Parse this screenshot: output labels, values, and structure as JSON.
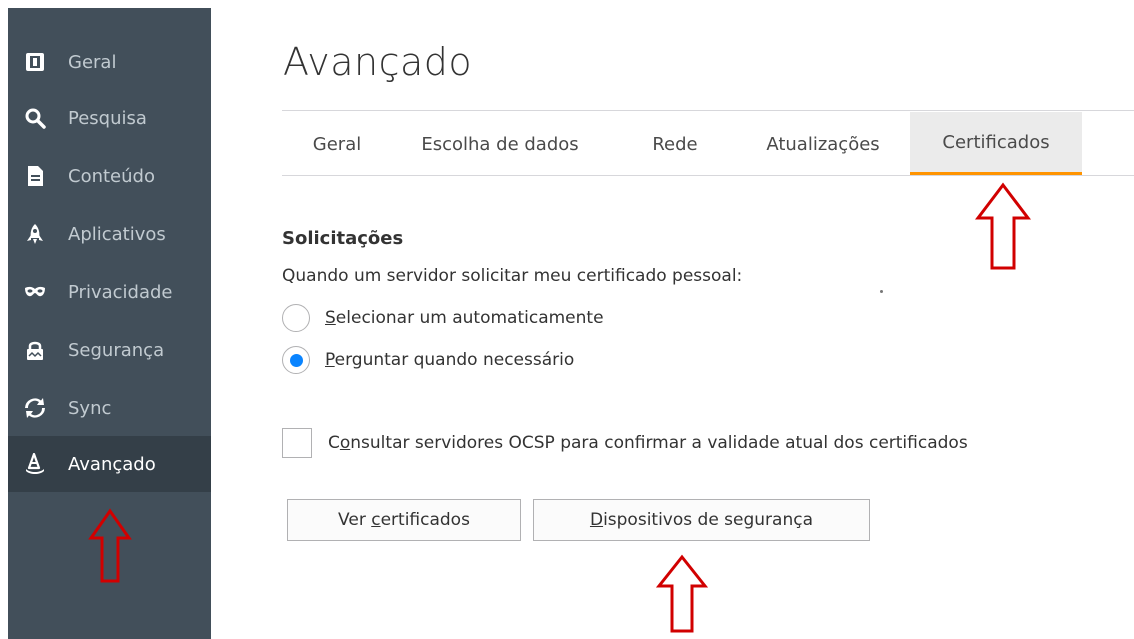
{
  "sidebar": {
    "items": [
      {
        "label": "Geral",
        "icon": "general-icon"
      },
      {
        "label": "Pesquisa",
        "icon": "search-icon"
      },
      {
        "label": "Conteúdo",
        "icon": "document-icon"
      },
      {
        "label": "Aplicativos",
        "icon": "rocket-icon"
      },
      {
        "label": "Privacidade",
        "icon": "mask-icon"
      },
      {
        "label": "Segurança",
        "icon": "lock-icon"
      },
      {
        "label": "Sync",
        "icon": "sync-icon"
      },
      {
        "label": "Avançado",
        "icon": "wizard-hat-icon"
      }
    ],
    "active_index": 7
  },
  "main": {
    "title": "Avançado",
    "tabs": [
      {
        "label": "Geral"
      },
      {
        "label": "Escolha de dados"
      },
      {
        "label": "Rede"
      },
      {
        "label": "Atualizações"
      },
      {
        "label": "Certificados"
      }
    ],
    "selected_tab": "Certificados"
  },
  "certificates": {
    "section_title": "Solicitações",
    "description": "Quando um servidor solicitar meu certificado pessoal:",
    "radio_auto": {
      "access": "S",
      "rest": "elecionar um automaticamente",
      "checked": false
    },
    "radio_ask": {
      "access": "P",
      "rest": "erguntar quando necessário",
      "checked": true
    },
    "ocsp": {
      "pre": "C",
      "access": "o",
      "rest": "nsultar servidores OCSP para confirmar a validade atual dos certificados",
      "checked": false
    },
    "view_button": {
      "pre": "Ver ",
      "access": "c",
      "rest": "ertificados"
    },
    "devices_button": {
      "pre": "",
      "access": "D",
      "rest": "ispositivos de segurança"
    }
  },
  "colors": {
    "sidebar_bg": "#424f5a",
    "sidebar_active_bg": "#343f48",
    "tab_accent": "#ff9400",
    "radio_accent": "#0a84ff",
    "annotation_arrow": "#d10000"
  }
}
